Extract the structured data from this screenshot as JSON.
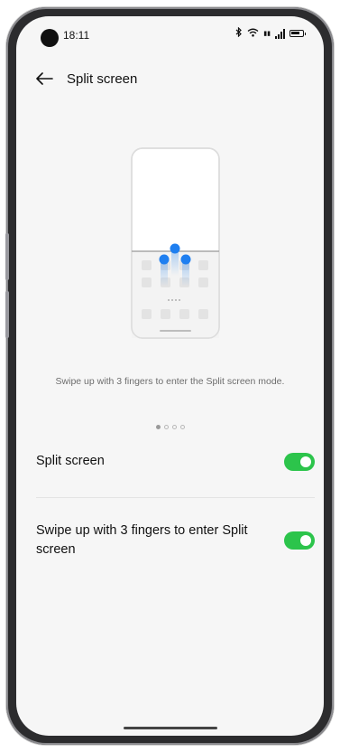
{
  "status_bar": {
    "time": "18:11"
  },
  "header": {
    "title": "Split screen"
  },
  "intro": {
    "caption": "Swipe up with 3 fingers to enter the Split screen mode.",
    "page_count": 4,
    "current_page": 1
  },
  "settings": {
    "split_screen": {
      "label": "Split screen",
      "enabled": true
    },
    "three_finger_swipe": {
      "label": "Swipe up with 3 fingers to enter Split screen",
      "enabled": true
    }
  },
  "colors": {
    "toggle_on": "#2cc44b",
    "gesture_dot": "#1f7ff0"
  }
}
